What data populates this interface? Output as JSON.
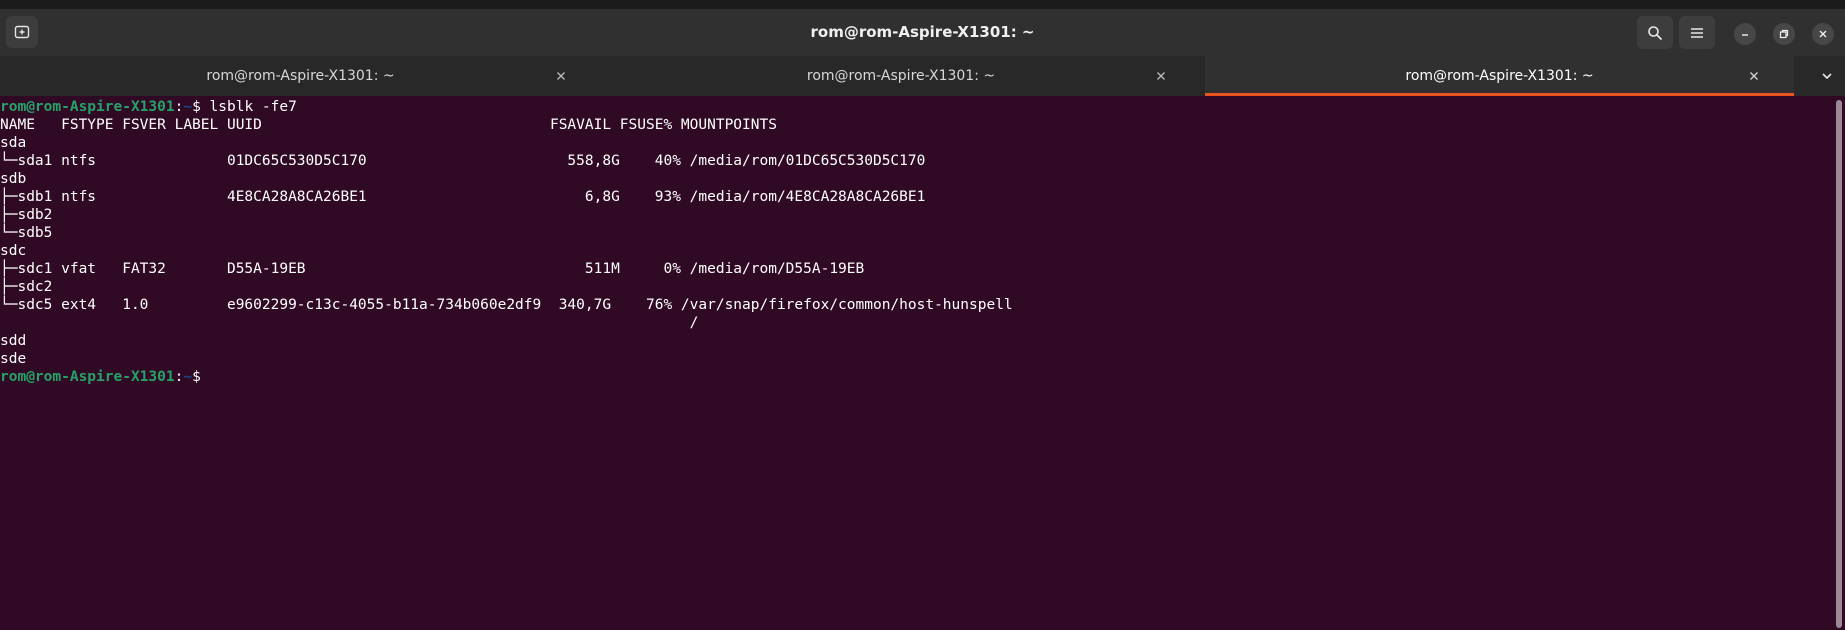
{
  "window": {
    "title": "rom@rom-Aspire-X1301: ~"
  },
  "tabs": [
    {
      "label": "rom@rom-Aspire-X1301: ~",
      "active": false
    },
    {
      "label": "rom@rom-Aspire-X1301: ~",
      "active": false
    },
    {
      "label": "rom@rom-Aspire-X1301: ~",
      "active": true
    }
  ],
  "icons": {
    "new_tab": "new-tab-icon",
    "search": "search-icon",
    "menu": "hamburger-menu-icon",
    "minimize": "minimize-icon",
    "maximize": "restore-icon",
    "close": "close-icon",
    "tab_close": "close-icon",
    "tabs_dropdown": "chevron-down-icon"
  },
  "colors": {
    "background": "#300a24",
    "prompt_user": "#26a269",
    "prompt_path": "#12488b",
    "active_tab_accent": "#e95420"
  },
  "terminal": {
    "prompt_user": "rom@rom-Aspire-X1301",
    "prompt_sep": ":",
    "prompt_path": "~",
    "prompt_symbol": "$",
    "command": " lsblk -fe7",
    "output": [
      "NAME   FSTYPE FSVER LABEL UUID                                 FSAVAIL FSUSE% MOUNTPOINTS",
      "sda",
      "└─sda1 ntfs               01DC65C530D5C170                       558,8G    40% /media/rom/01DC65C530D5C170",
      "sdb",
      "├─sdb1 ntfs               4E8CA28A8CA26BE1                         6,8G    93% /media/rom/4E8CA28A8CA26BE1",
      "├─sdb2",
      "└─sdb5",
      "sdc",
      "├─sdc1 vfat   FAT32       D55A-19EB                                511M     0% /media/rom/D55A-19EB",
      "├─sdc2",
      "└─sdc5 ext4   1.0         e9602299-c13c-4055-b11a-734b060e2df9  340,7G    76% /var/snap/firefox/common/host-hunspell",
      "                                                                               /",
      "sdd",
      "sde"
    ]
  }
}
